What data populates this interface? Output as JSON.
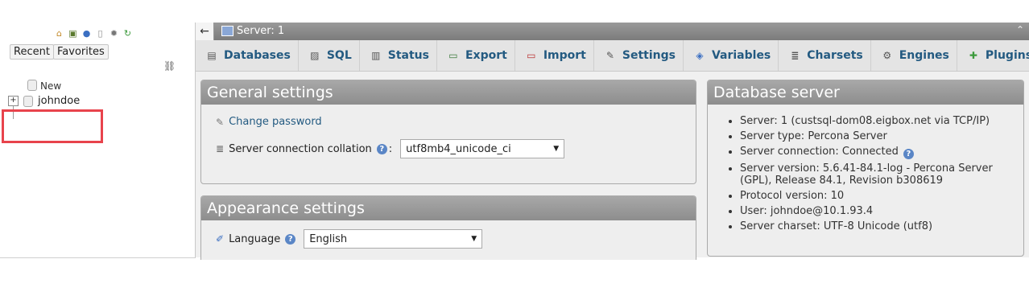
{
  "sidebar": {
    "icons": [
      "home-icon",
      "logout-icon",
      "help-icon",
      "docs-icon",
      "settings-icon",
      "reload-icon"
    ],
    "recent_label": "Recent",
    "favorites_label": "Favorites",
    "tree_new_label": "New",
    "tree_db_label": "johndoe"
  },
  "titlebar": {
    "server_label": "Server: 1"
  },
  "tabs": [
    {
      "label": "Databases",
      "icon": "database-icon"
    },
    {
      "label": "SQL",
      "icon": "sql-icon"
    },
    {
      "label": "Status",
      "icon": "status-icon"
    },
    {
      "label": "Export",
      "icon": "export-icon"
    },
    {
      "label": "Import",
      "icon": "import-icon"
    },
    {
      "label": "Settings",
      "icon": "wrench-icon"
    },
    {
      "label": "Variables",
      "icon": "variables-icon"
    },
    {
      "label": "Charsets",
      "icon": "charsets-icon"
    },
    {
      "label": "Engines",
      "icon": "engines-icon"
    },
    {
      "label": "Plugins",
      "icon": "plugin-icon"
    }
  ],
  "general": {
    "title": "General settings",
    "change_password": "Change password",
    "collation_label": "Server connection collation",
    "collation_value": "utf8mb4_unicode_ci"
  },
  "appearance": {
    "title": "Appearance settings",
    "language_label": "Language",
    "language_value": "English"
  },
  "db_server": {
    "title": "Database server",
    "items": [
      "Server: 1 (custsql-dom08.eigbox.net via TCP/IP)",
      "Server type: Percona Server",
      "Server connection: Connected",
      "Server version: 5.6.41-84.1-log - Percona Server (GPL), Release 84.1, Revision b308619",
      "Protocol version: 10",
      "User: johndoe@10.1.93.4",
      "Server charset: UTF-8 Unicode (utf8)"
    ]
  },
  "colors": {
    "link": "#235a81",
    "highlight": "#e8434c"
  }
}
